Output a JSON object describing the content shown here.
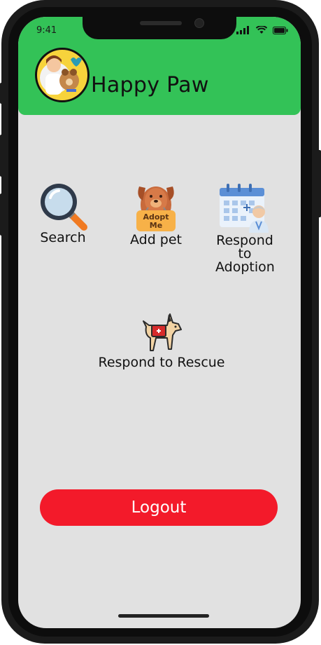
{
  "status_bar": {
    "time": "9:41"
  },
  "header": {
    "title": "Happy Paw",
    "avatar_icon": "owner-with-dog-avatar",
    "color": "#33c257"
  },
  "actions": [
    {
      "label": "Search",
      "icon": "magnifier-icon"
    },
    {
      "label": "Add pet",
      "icon": "adopt-me-dog-icon",
      "badge_text": "Adopt Me"
    },
    {
      "label": "Respond to Adoption",
      "icon": "calendar-vet-icon"
    },
    {
      "label": "Respond to Rescue",
      "icon": "rescue-dog-icon"
    }
  ],
  "logout": {
    "label": "Logout",
    "color": "#f31a2a"
  }
}
